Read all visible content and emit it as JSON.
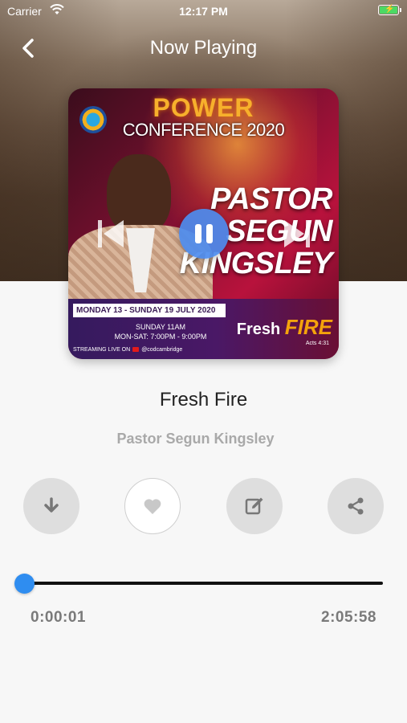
{
  "status_bar": {
    "carrier": "Carrier",
    "time": "12:17 PM",
    "icons": [
      "wifi-icon",
      "battery-icon"
    ],
    "battery_color": "#4cd964"
  },
  "nav": {
    "title": "Now Playing",
    "back_icon": "chevron-left-icon"
  },
  "artwork": {
    "brand_top": "POWER",
    "brand_bottom": "CONFERENCE 2020",
    "speaker_name": "PASTOR\nSEGUN\nKINGSLEY",
    "dates": "MONDAY 13 - SUNDAY 19 JULY 2020",
    "schedule": "SUNDAY 11AM\nMON-SAT: 7:00PM - 9:00PM",
    "streaming": "STREAMING LIVE ON",
    "handle": "@codcambridge",
    "theme_a": "Fresh",
    "theme_b": "FIRE",
    "scripture": "Acts 4:31"
  },
  "player": {
    "state": "playing",
    "controls": [
      "previous-icon",
      "pause-icon",
      "next-icon"
    ],
    "accent_color": "#2f8df0"
  },
  "track": {
    "title": "Fresh Fire",
    "artist": "Pastor Segun Kingsley"
  },
  "actions": [
    {
      "icon": "download-icon"
    },
    {
      "icon": "heart-icon"
    },
    {
      "icon": "edit-icon"
    },
    {
      "icon": "share-icon"
    }
  ],
  "progress": {
    "elapsed": "0:00:01",
    "total": "2:05:58",
    "fraction": 0.0001
  }
}
